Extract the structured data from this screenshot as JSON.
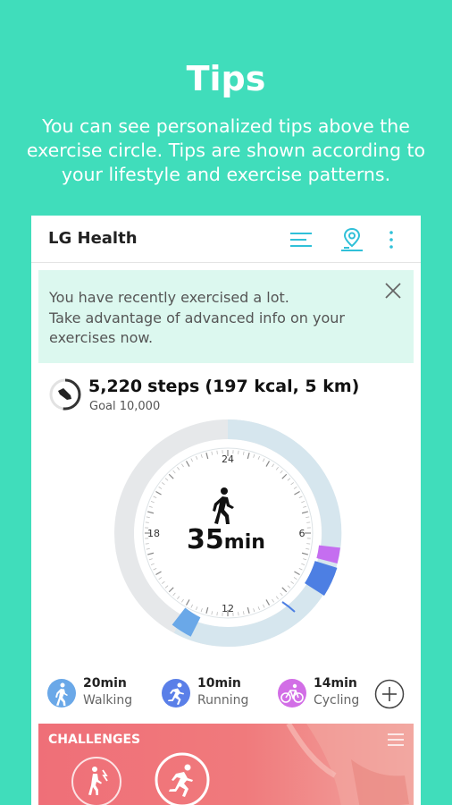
{
  "promo": {
    "title": "Tips",
    "description": "You can see personalized tips above the exercise circle. Tips are shown according to your lifestyle and exercise patterns."
  },
  "app": {
    "title": "LG Health",
    "icons": [
      "list-icon",
      "map-pin-icon",
      "more-vert-icon"
    ]
  },
  "tip": {
    "line1": "You have recently exercised a lot.",
    "line2": "Take advantage of advanced info on your",
    "line3": "exercises now.",
    "close_icon": "close-icon"
  },
  "steps": {
    "count": "5,220",
    "unit": "steps",
    "detail": "(197 kcal, 5 km)",
    "goal": "Goal 10,000",
    "progress": 0.522
  },
  "dial": {
    "labels": [
      "24",
      "6",
      "12",
      "18"
    ],
    "time_value": "35",
    "time_unit": "min"
  },
  "activities": [
    {
      "value": "20min",
      "name": "Walking",
      "color": "#6aa8e8",
      "icon": "walking-icon"
    },
    {
      "value": "10min",
      "name": "Running",
      "color": "#5a7fe8",
      "icon": "running-icon"
    },
    {
      "value": "14min",
      "name": "Cycling",
      "color": "#d26ee6",
      "icon": "cycling-icon"
    }
  ],
  "challenges": {
    "title": "CHALLENGES"
  },
  "colors": {
    "background": "#40ddbb",
    "tip_background": "#dcf8ef",
    "accent": "#30c0d8",
    "ring_track": "#e6e8ea",
    "ring_today": "#d6e6ee",
    "walking": "#6aa8e8",
    "running": "#4d7fe3",
    "cycling": "#c56ef0",
    "challenge": "#ef6f78"
  }
}
